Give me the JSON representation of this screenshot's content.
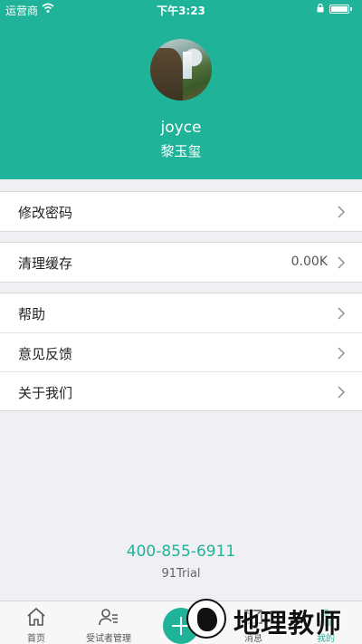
{
  "status_bar": {
    "carrier": "运营商",
    "time": "下午3:23"
  },
  "profile": {
    "username": "joyce",
    "realname": "黎玉玺"
  },
  "menu": {
    "change_password": "修改密码",
    "clear_cache": "清理缓存",
    "cache_size": "0.00K",
    "help": "帮助",
    "feedback": "意见反馈",
    "about": "关于我们"
  },
  "footer": {
    "phone": "400-855-6911",
    "brand": "91Trial"
  },
  "tabbar": {
    "home": "首页",
    "subjects": "受试者管理",
    "messages": "消息",
    "mine": "我的"
  },
  "watermark": {
    "text": "地理教师"
  },
  "colors": {
    "accent": "#1fb399",
    "background": "#efeff4"
  }
}
